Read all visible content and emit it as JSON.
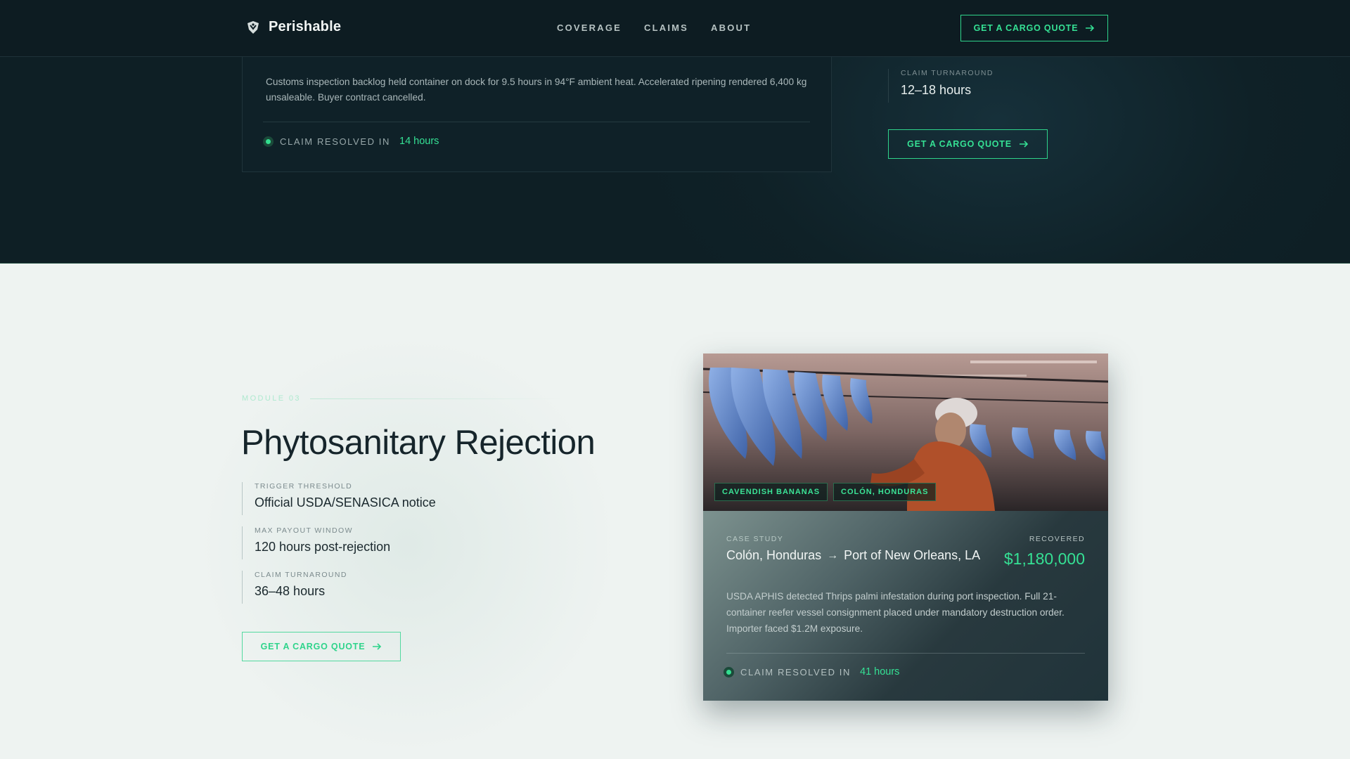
{
  "header": {
    "brand": "Perishable",
    "nav": [
      "COVERAGE",
      "CLAIMS",
      "ABOUT"
    ],
    "cta": "GET A CARGO QUOTE"
  },
  "top_card": {
    "description": "Customs inspection backlog held container on dock for 9.5 hours in 94°F ambient heat. Accelerated ripening rendered 6,400 kg unsaleable. Buyer contract cancelled.",
    "status_label": "CLAIM RESOLVED IN",
    "status_value": "14 hours"
  },
  "top_spec": {
    "label": "CLAIM TURNAROUND",
    "value": "12–18 hours",
    "cta": "GET A CARGO QUOTE"
  },
  "module": {
    "tag": "MODULE 03",
    "title": "Phytosanitary Rejection",
    "specs": [
      {
        "label": "TRIGGER THRESHOLD",
        "value": "Official USDA/SENASICA notice"
      },
      {
        "label": "MAX PAYOUT WINDOW",
        "value": "120 hours post-rejection"
      },
      {
        "label": "CLAIM TURNAROUND",
        "value": "36–48 hours"
      }
    ],
    "cta": "GET A CARGO QUOTE"
  },
  "case_card": {
    "tags": [
      "CAVENDISH BANANAS",
      "COLÓN, HONDURAS"
    ],
    "route_label": "CASE STUDY",
    "origin": "Colón, Honduras",
    "arrow": "→",
    "destination": "Port of New Orleans, LA",
    "recovered_label": "RECOVERED",
    "recovered_value": "$1,180,000",
    "description": "USDA APHIS detected Thrips palmi infestation during port inspection. Full 21-container reefer vessel consignment placed under mandatory destruction order. Importer faced $1.2M exposure.",
    "status_label": "CLAIM RESOLVED IN",
    "status_value": "41 hours"
  },
  "colors": {
    "accent": "#35e094",
    "dark_bg": "#0f2026",
    "light_bg": "#eef3f1"
  },
  "icons": [
    "shield-logo-icon",
    "arrow-right-icon",
    "status-dot-icon"
  ]
}
